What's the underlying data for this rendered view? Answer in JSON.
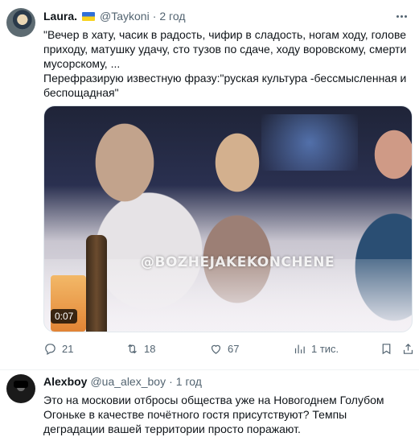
{
  "tweet": {
    "author_name": "Laura.",
    "handle": "@Taykoni",
    "separator": "·",
    "time": "2 год",
    "text_lines": [
      "\"Вечер в хату, часик в радость, чифир в сладость, ногам ходу, голове приходу, матушку удачу, сто тузов по сдаче, ходу воровскому, смерти мусорскому, ...",
      "Перефразирую известную фразу:\"руская культура -бессмысленная и беспощадная\""
    ],
    "media": {
      "watermark": "@BOZHEJAKEKONCHENE",
      "duration": "0:07"
    },
    "actions": {
      "replies": "21",
      "retweets": "18",
      "likes": "67",
      "views": "1 тис."
    }
  },
  "reply": {
    "author_name": "Alexboy",
    "handle": "@ua_alex_boy",
    "separator": "·",
    "time": "1 год",
    "text": "Это на московии отбросы общества уже на Новогоднем Голубом Огоньке в качестве почётного гостя присутствуют? Темпы деградации вашей территории просто поражают."
  },
  "colors": {
    "text_primary": "#0f1419",
    "text_secondary": "#536471",
    "divider": "#eff3f4"
  },
  "icons": [
    "more-icon",
    "reply-icon",
    "retweet-icon",
    "like-icon",
    "views-icon",
    "bookmark-icon",
    "share-icon",
    "ukraine-flag-icon"
  ]
}
